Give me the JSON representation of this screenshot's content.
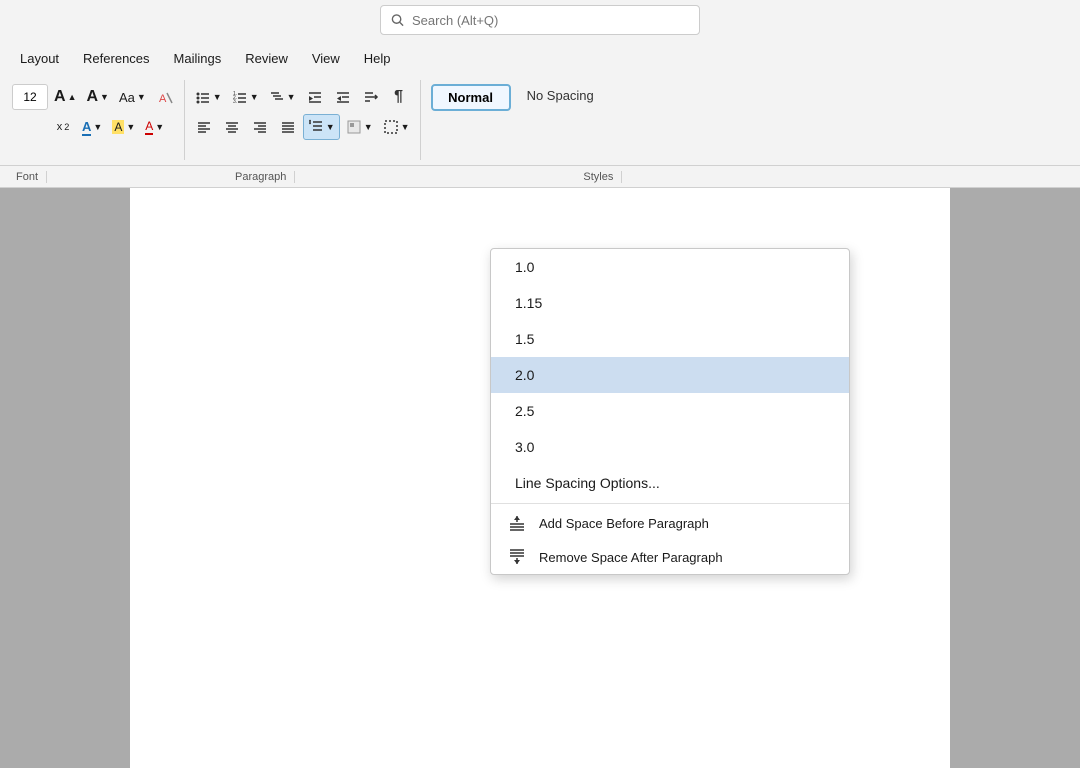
{
  "titleBar": {
    "searchPlaceholder": "Search (Alt+Q)"
  },
  "menuBar": {
    "items": [
      "Layout",
      "References",
      "Mailings",
      "Review",
      "View",
      "Help"
    ]
  },
  "ribbon": {
    "fontGroup": {
      "label": "Font",
      "fontSize": "12",
      "buttons": [
        {
          "id": "increase-font",
          "label": "A↑"
        },
        {
          "id": "decrease-font",
          "label": "A↓"
        },
        {
          "id": "font-case",
          "label": "Aa"
        },
        {
          "id": "clear-format",
          "label": "A✕"
        }
      ]
    },
    "paragraphGroup": {
      "label": "Paragraph"
    },
    "stylesGroup": {
      "label": "Styles",
      "items": [
        {
          "id": "normal",
          "label": "Normal",
          "active": true
        },
        {
          "id": "no-spacing",
          "label": "No Spacing"
        }
      ]
    }
  },
  "dropdown": {
    "lineSpacingItems": [
      {
        "value": "1.0",
        "highlighted": false
      },
      {
        "value": "1.15",
        "highlighted": false
      },
      {
        "value": "1.5",
        "highlighted": false
      },
      {
        "value": "2.0",
        "highlighted": true
      },
      {
        "value": "2.5",
        "highlighted": false
      },
      {
        "value": "3.0",
        "highlighted": false
      }
    ],
    "optionsLabel": "Line Spacing Options...",
    "addSpaceLabel": "Add Space Before Paragraph",
    "removeSpaceLabel": "Remove Space After Paragraph"
  },
  "bottomLabels": {
    "font": "Font",
    "paragraph": "Paragraph",
    "styles": "Styles"
  }
}
